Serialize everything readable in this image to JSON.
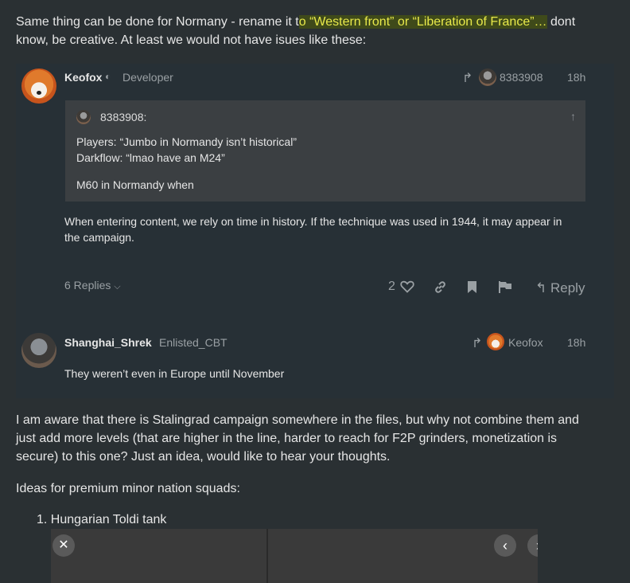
{
  "intro": {
    "before": "Same thing can be done for Normany - rename it t",
    "highlight": "o “Western front” or “Liberation of France”…",
    "after_line1": " dont",
    "line2": "know, be creative. At least we would not have isues like these:"
  },
  "post1": {
    "username": "Keofox",
    "title": "Developer",
    "reply_to": "8383908",
    "time": "18h",
    "quote": {
      "author": "8383908:",
      "line1": "Players: “Jumbo in Normandy isn’t historical”",
      "line2": "Darkflow: “lmao have an M24”",
      "line3": "M60 in Normandy when"
    },
    "body_line1": "When entering content, we rely on time in history. If the technique was used in 1944, it may appear in",
    "body_line2": "the campaign.",
    "replies": "6 Replies",
    "likes": "2",
    "reply_label": "Reply"
  },
  "post2": {
    "username": "Shanghai_Shrek",
    "title": "Enlisted_CBT",
    "reply_to": "Keofox",
    "time": "18h",
    "body": "They weren’t even in Europe until November"
  },
  "para2": {
    "line1": "I am aware that there is Stalingrad campaign somewhere in the files, but why not combine them and",
    "line2": "just add more levels (that are higher in the line, harder to reach for F2P grinders, monetization is",
    "line3": "secure) to this one? Just an idea, would like to hear your thoughts."
  },
  "para3": "Ideas for premium minor nation squads:",
  "list_item1": "1. Hungarian Toldi tank",
  "icons": {
    "close": "close-icon",
    "prev": "chevron-left-icon"
  }
}
